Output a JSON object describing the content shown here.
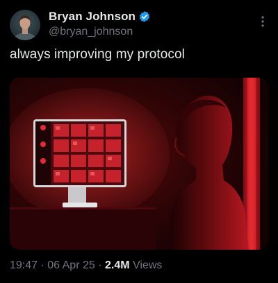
{
  "tweet": {
    "author": {
      "display_name": "Bryan Johnson",
      "handle": "@bryan_johnson",
      "verified": true,
      "verified_color": "#1d9bf0"
    },
    "text": "always improving my protocol",
    "meta": {
      "time": "19:47",
      "separator": " · ",
      "date": "06 Apr 25",
      "views_count": "2.4M",
      "views_label": " Views"
    }
  },
  "colors": {
    "background": "#000000",
    "primary_text": "#e7e9ea",
    "secondary_text": "#71767b",
    "media_red": "#c4141e"
  },
  "icons": {
    "more": "more-vertical-icon",
    "verified": "verified-badge-icon"
  }
}
